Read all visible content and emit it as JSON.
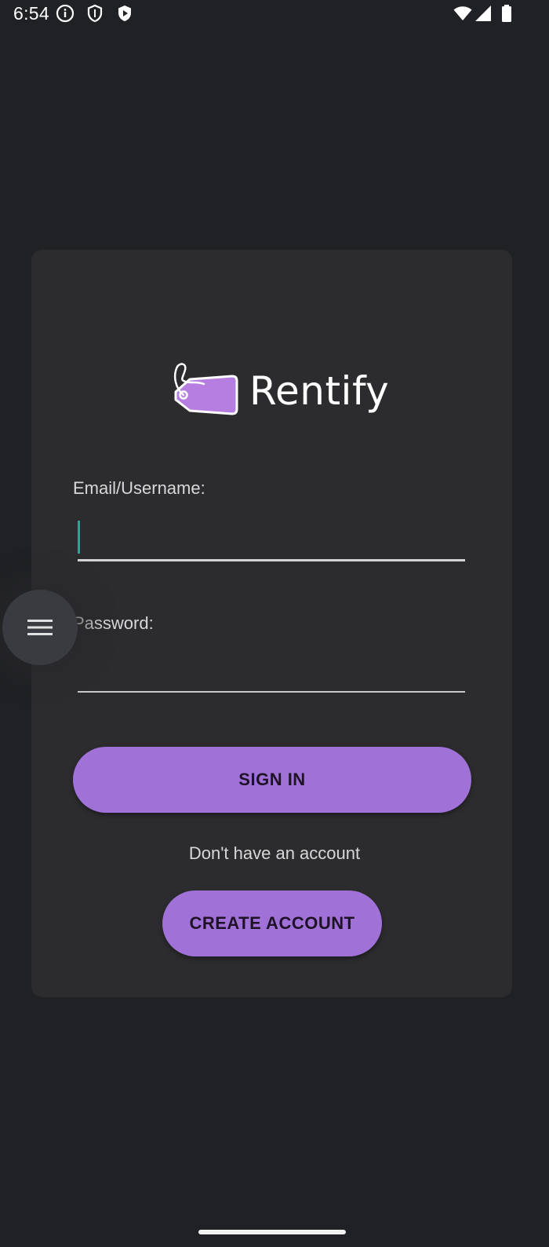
{
  "status_bar": {
    "time": "6:54",
    "icons": [
      "info-icon",
      "shield-icon",
      "play-badge-icon",
      "wifi-icon",
      "signal-icon",
      "battery-icon"
    ]
  },
  "app": {
    "name": "Rentify",
    "accent_color": "#a071d6",
    "logo_icon": "price-tag-icon"
  },
  "form": {
    "email_label": "Email/Username:",
    "email_value": "",
    "password_label": "Password:",
    "password_value": "",
    "sign_in_label": "SIGN IN",
    "no_account_text": "Don't have an account",
    "create_account_label": "CREATE ACCOUNT"
  },
  "overlay": {
    "menu_icon": "hamburger-menu-icon"
  }
}
